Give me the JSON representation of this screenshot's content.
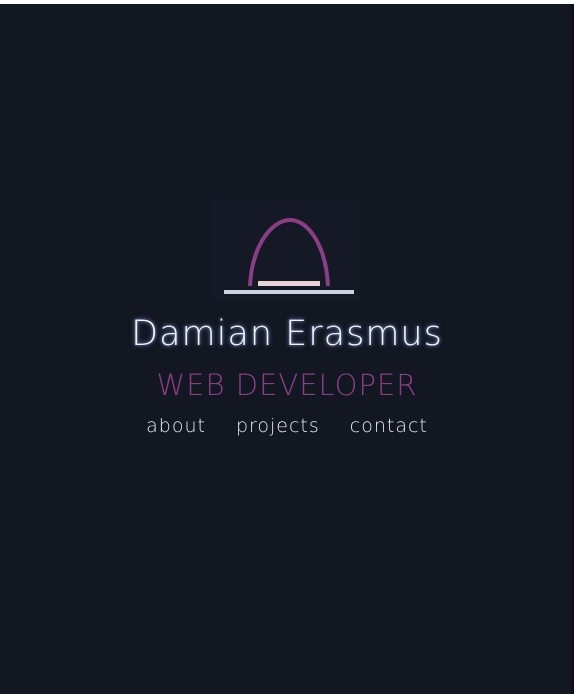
{
  "profile": {
    "name": "Damian Erasmus",
    "role": "WEB DEVELOPER"
  },
  "nav": {
    "items": [
      "about",
      "projects",
      "contact"
    ]
  },
  "logo": {
    "icon": "arch-logo-icon",
    "arch_color": "#8a3e86",
    "base_color": "#c9d3e6",
    "bar_color": "#e7d3d6"
  },
  "colors": {
    "background": "#131722",
    "accent": "#8a3e86",
    "text": "#eef2ff"
  }
}
